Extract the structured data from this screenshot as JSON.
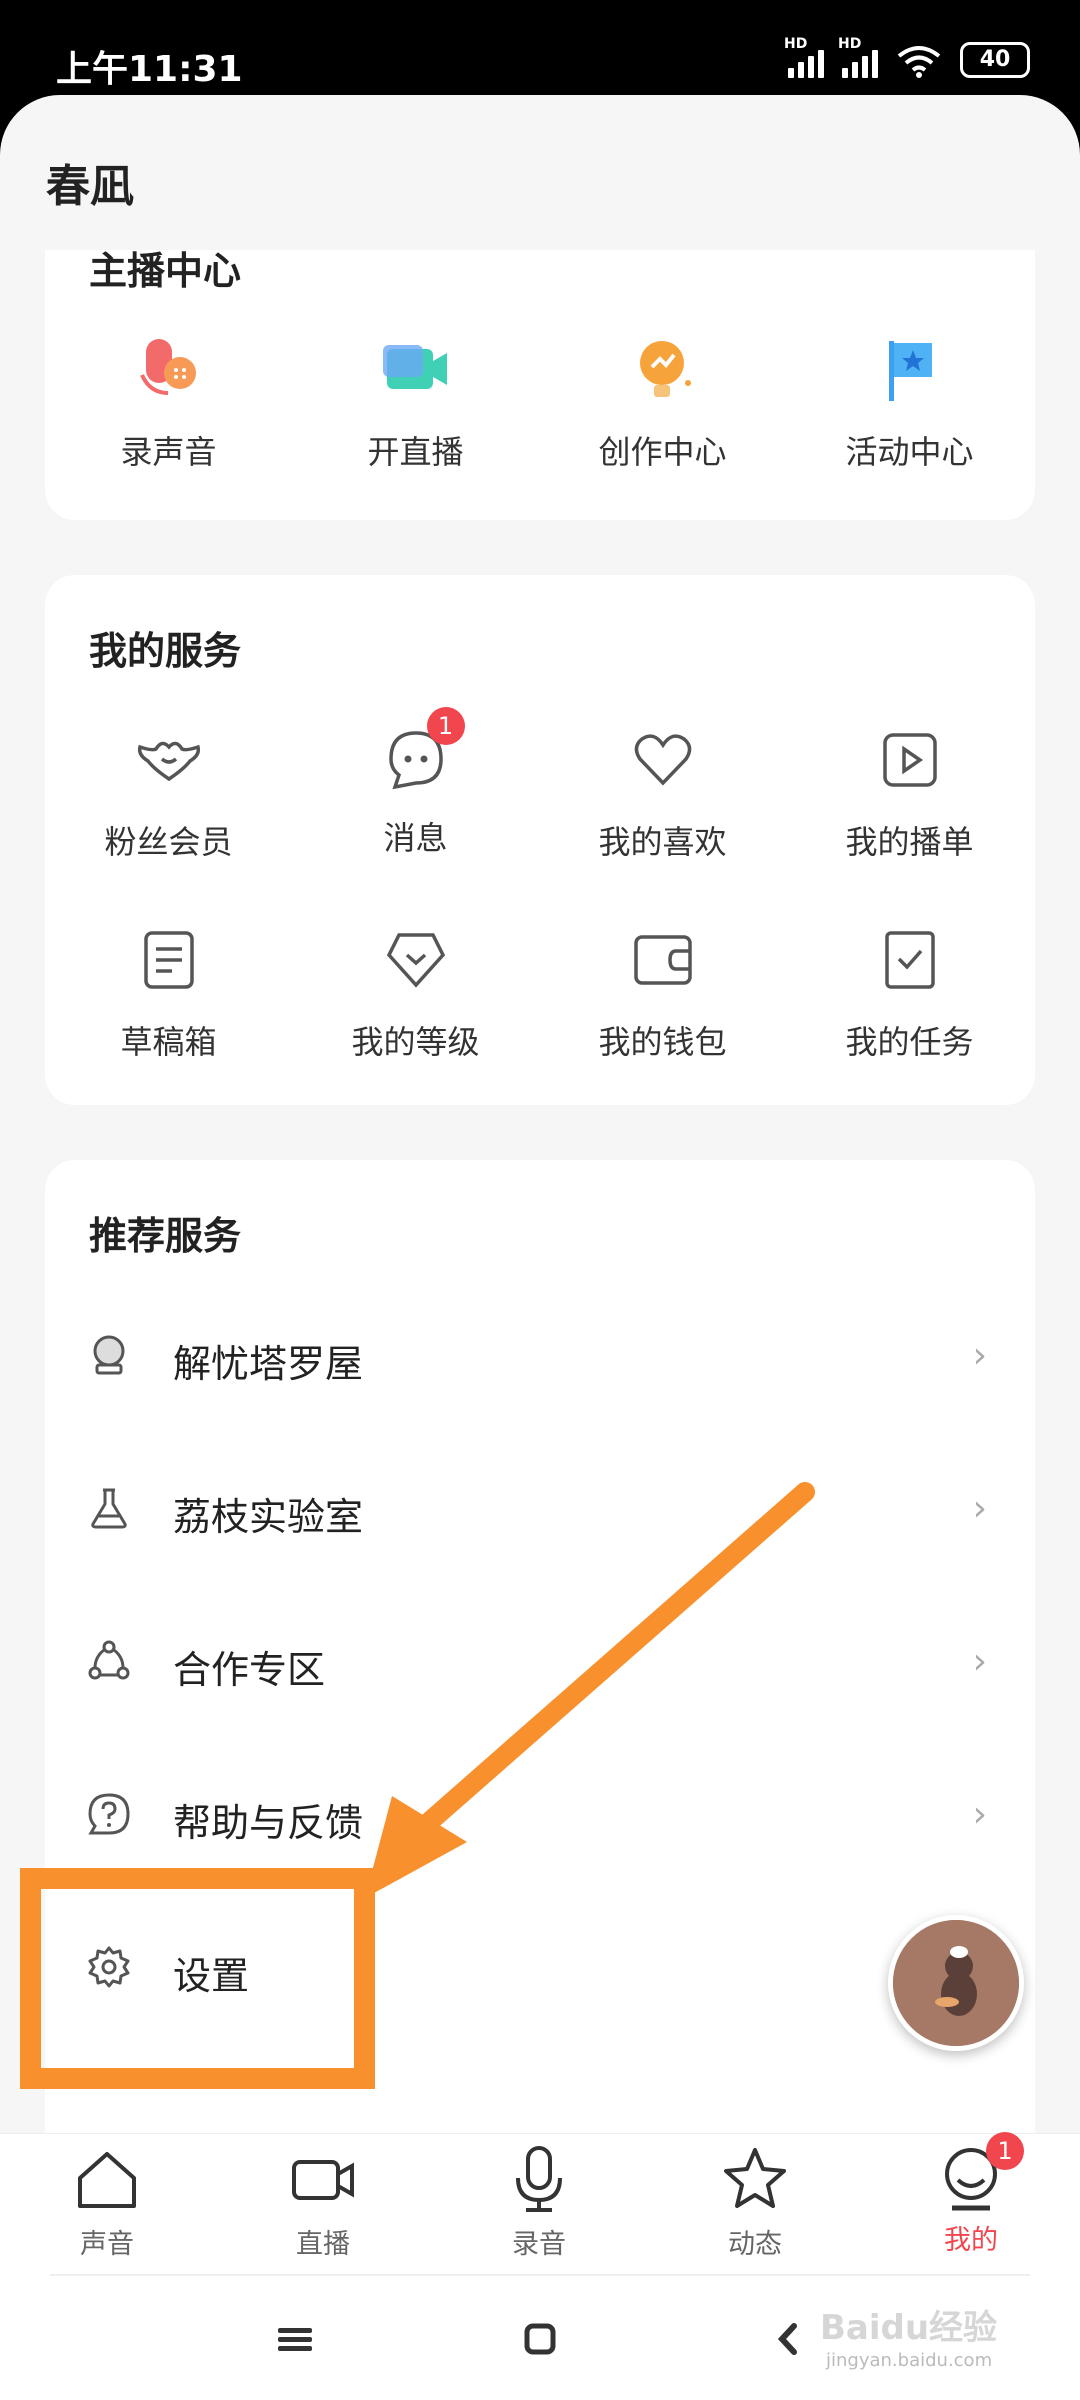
{
  "status_bar": {
    "time": "上午11:31",
    "signal1_tag": "HD",
    "signal2_tag": "HD",
    "battery": "40"
  },
  "sheet": {
    "title": "春凪"
  },
  "anchor_center": {
    "title": "主播中心",
    "items": [
      {
        "label": "录声音",
        "icon": "record-voice-icon"
      },
      {
        "label": "开直播",
        "icon": "go-live-icon"
      },
      {
        "label": "创作中心",
        "icon": "creator-center-icon"
      },
      {
        "label": "活动中心",
        "icon": "activity-center-icon"
      }
    ]
  },
  "my_services": {
    "title": "我的服务",
    "items": [
      {
        "label": "粉丝会员",
        "icon": "fan-member-icon"
      },
      {
        "label": "消息",
        "icon": "message-icon",
        "badge": "1"
      },
      {
        "label": "我的喜欢",
        "icon": "heart-icon"
      },
      {
        "label": "我的播单",
        "icon": "playlist-icon"
      },
      {
        "label": "草稿箱",
        "icon": "drafts-icon"
      },
      {
        "label": "我的等级",
        "icon": "level-icon"
      },
      {
        "label": "我的钱包",
        "icon": "wallet-icon"
      },
      {
        "label": "我的任务",
        "icon": "tasks-icon"
      }
    ]
  },
  "recommended": {
    "title": "推荐服务",
    "items": [
      {
        "label": "解忧塔罗屋",
        "icon": "crystal-ball-icon"
      },
      {
        "label": "荔枝实验室",
        "icon": "flask-icon"
      },
      {
        "label": "合作专区",
        "icon": "cooperation-icon"
      },
      {
        "label": "帮助与反馈",
        "icon": "help-icon"
      },
      {
        "label": "设置",
        "icon": "gear-icon"
      }
    ]
  },
  "tabs": [
    {
      "label": "声音",
      "icon": "home-icon"
    },
    {
      "label": "直播",
      "icon": "video-icon"
    },
    {
      "label": "录音",
      "icon": "microphone-icon"
    },
    {
      "label": "动态",
      "icon": "star-icon"
    },
    {
      "label": "我的",
      "icon": "profile-icon",
      "badge": "1",
      "active": true
    }
  ],
  "watermark": {
    "text": "Baidu经验",
    "sub": "jingyan.baidu.com"
  },
  "colors": {
    "accent": "#f2464e",
    "annotation": "#f7902d",
    "background": "#f6f6f6"
  }
}
